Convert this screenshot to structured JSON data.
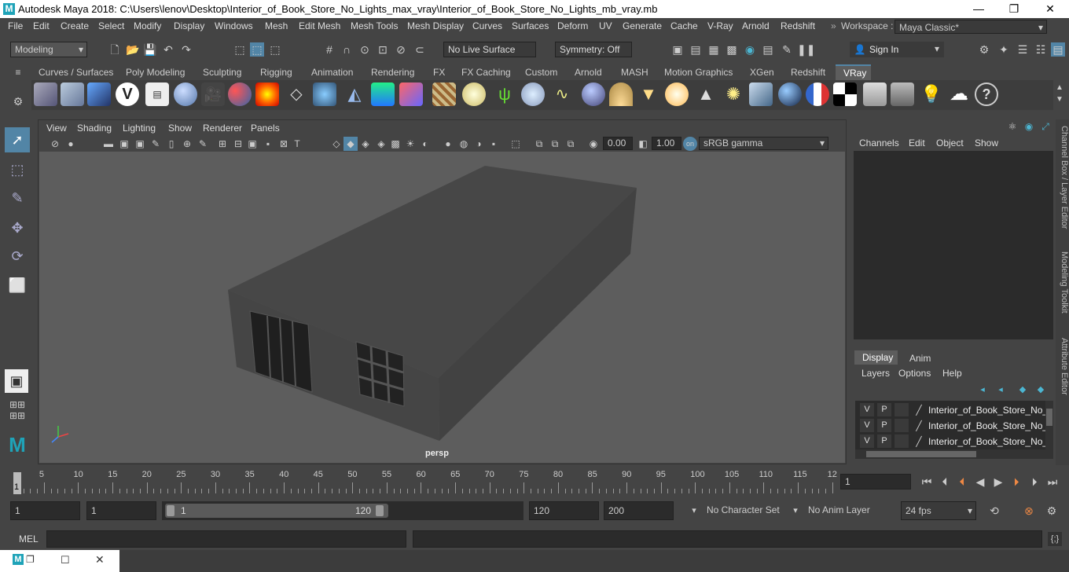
{
  "window": {
    "title": "Autodesk Maya 2018: C:\\Users\\lenov\\Desktop\\Interior_of_Book_Store_No_Lights_max_vray\\Interior_of_Book_Store_No_Lights_mb_vray.mb",
    "minimize": "—",
    "maximize": "❐",
    "close": "✕"
  },
  "menubar": {
    "items": [
      "File",
      "Edit",
      "Create",
      "Select",
      "Modify",
      "Display",
      "Windows",
      "Mesh",
      "Edit Mesh",
      "Mesh Tools",
      "Mesh Display",
      "Curves",
      "Surfaces",
      "Deform",
      "UV",
      "Generate",
      "Cache",
      "V-Ray",
      "Arnold",
      "Redshift"
    ],
    "workspace_label": "Workspace :",
    "workspace_value": "Maya Classic*"
  },
  "statusline": {
    "mode": "Modeling",
    "live_surface": "No Live Surface",
    "symmetry": "Symmetry: Off",
    "sign_in": "Sign In"
  },
  "shelf_tabs": [
    "Curves / Surfaces",
    "Poly Modeling",
    "Sculpting",
    "Rigging",
    "Animation",
    "Rendering",
    "FX",
    "FX Caching",
    "Custom",
    "Arnold",
    "MASH",
    "Motion Graphics",
    "XGen",
    "Redshift",
    "VRay"
  ],
  "shelf_active": "VRay",
  "viewport": {
    "menus": [
      "View",
      "Shading",
      "Lighting",
      "Show",
      "Renderer",
      "Panels"
    ],
    "exposure": "0.00",
    "gamma": "1.00",
    "color_space": "sRGB gamma",
    "camera_label": "persp"
  },
  "channel_box": {
    "menus": [
      "Channels",
      "Edit",
      "Object",
      "Show"
    ]
  },
  "layer_editor": {
    "tabs": [
      "Display",
      "Anim"
    ],
    "menus": [
      "Layers",
      "Options",
      "Help"
    ],
    "layers": [
      {
        "v": "V",
        "p": "P",
        "name": "Interior_of_Book_Store_No_"
      },
      {
        "v": "V",
        "p": "P",
        "name": "Interior_of_Book_Store_No_"
      },
      {
        "v": "V",
        "p": "P",
        "name": "Interior_of_Book_Store_No_"
      }
    ]
  },
  "side_tabs": [
    "Channel Box / Layer Editor",
    "Modeling Toolkit",
    "Attribute Editor"
  ],
  "timeline": {
    "ticks": [
      "5",
      "10",
      "15",
      "20",
      "25",
      "30",
      "35",
      "40",
      "45",
      "50",
      "55",
      "60",
      "65",
      "70",
      "75",
      "80",
      "85",
      "90",
      "95",
      "100",
      "105",
      "110",
      "115",
      "12"
    ],
    "current_frame_marker": "1",
    "current_frame": "1"
  },
  "range": {
    "start": "1",
    "anim_start": "1",
    "slider_start": "1",
    "slider_end": "120",
    "end": "120",
    "anim_end": "200",
    "character_set": "No Character Set",
    "anim_layer": "No Anim Layer",
    "fps": "24 fps"
  },
  "cmdline": {
    "label": "MEL"
  },
  "colors": {
    "accent": "#5285a6",
    "panel": "#444444",
    "field": "#2b2b2b",
    "viewport_bg": "#5d5d5d",
    "maya_teal": "#1fa3b8"
  }
}
